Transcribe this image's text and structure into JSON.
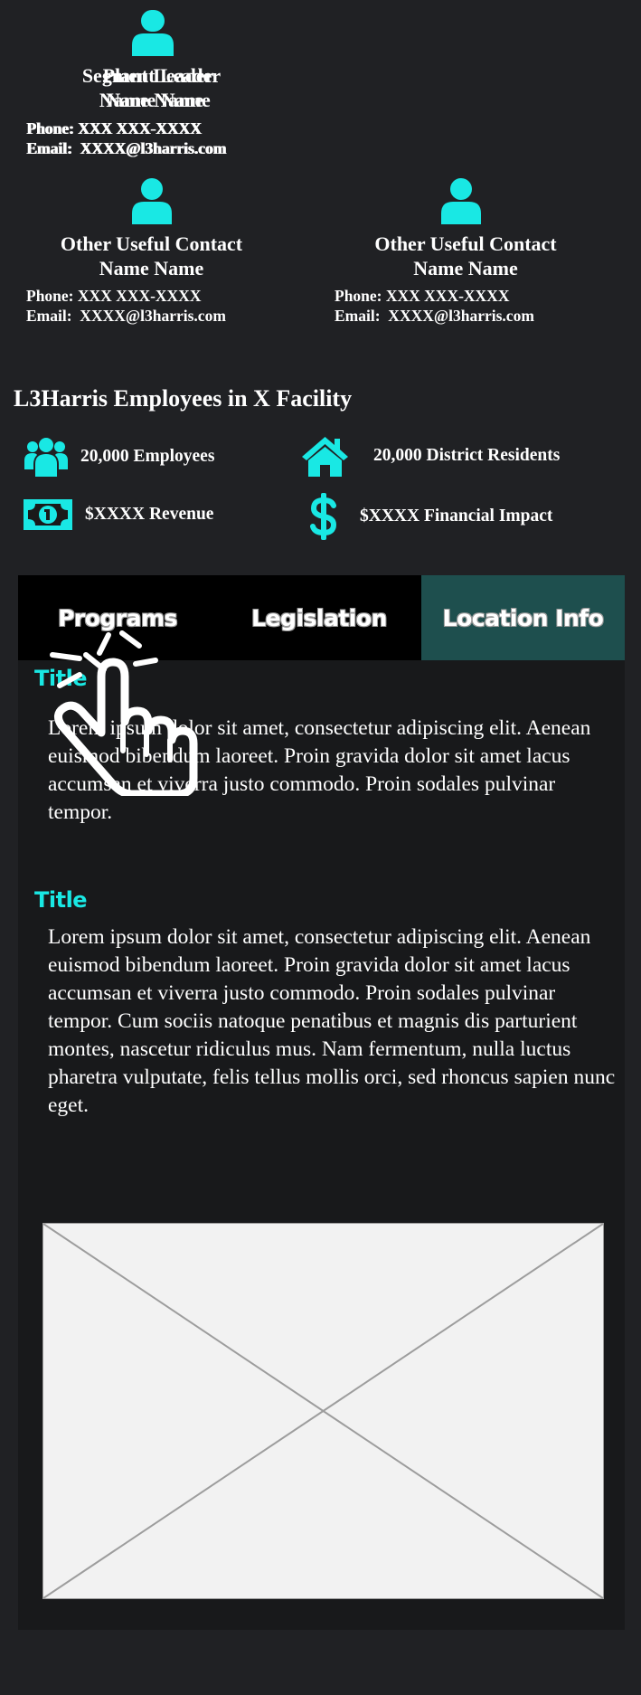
{
  "contacts": [
    {
      "role": "Segment Leader",
      "name": "Name Name",
      "phone": "Phone: XXX XXX-XXXX",
      "email": "Email:  XXXX@l3harris.com"
    },
    {
      "role": "Plant Leader",
      "name": "Name Name",
      "phone": "Phone: XXX XXX-XXXX",
      "email": "Email:  XXXX@l3harris.com"
    },
    {
      "role": "Other Useful Contact",
      "name": "Name Name",
      "phone": "Phone: XXX XXX-XXXX",
      "email": "Email:  XXXX@l3harris.com"
    },
    {
      "role": "Other Useful Contact",
      "name": "Name Name",
      "phone": "Phone: XXX XXX-XXXX",
      "email": "Email:  XXXX@l3harris.com"
    }
  ],
  "employees": {
    "title": "L3Harris Employees in X Facility",
    "stats": [
      {
        "icon": "users-icon",
        "label": "20,000 Employees"
      },
      {
        "icon": "house-icon",
        "label": "20,000 District Residents"
      },
      {
        "icon": "money-bill-icon",
        "label": "$XXXX Revenue"
      },
      {
        "icon": "dollar-sign-icon",
        "label": "$XXXX Financial Impact"
      }
    ]
  },
  "tabs": [
    {
      "label": "Programs",
      "active": false
    },
    {
      "label": "Legislation",
      "active": false
    },
    {
      "label": "Location Info",
      "active": true
    }
  ],
  "sections": [
    {
      "title": "Title",
      "body": "Lorem ipsum dolor sit amet, consectetur adipiscing elit. Aenean euismod bibendum laoreet. Proin gravida dolor sit amet lacus accumsan et viverra justo commodo. Proin sodales pulvinar tempor."
    },
    {
      "title": "Title",
      "body": "Lorem ipsum dolor sit amet, consectetur adipiscing elit. Aenean euismod bibendum laoreet. Proin gravida dolor sit amet lacus accumsan et viverra justo commodo. Proin sodales pulvinar tempor. Cum sociis natoque penatibus et magnis dis parturient montes, nascetur ridiculus mus. Nam fermentum, nulla luctus pharetra vulputate, felis tellus mollis orci, sed rhoncus sapien nunc eget."
    }
  ],
  "colors": {
    "accent": "#19e8e4",
    "background": "#202124",
    "panel": "#18191b",
    "tabbar": "#000000",
    "active_tab": "#1e4f4e"
  },
  "icons": {
    "contact": "person-icon",
    "pointer": "hand-pointer-icon",
    "image": "image-placeholder-icon"
  }
}
